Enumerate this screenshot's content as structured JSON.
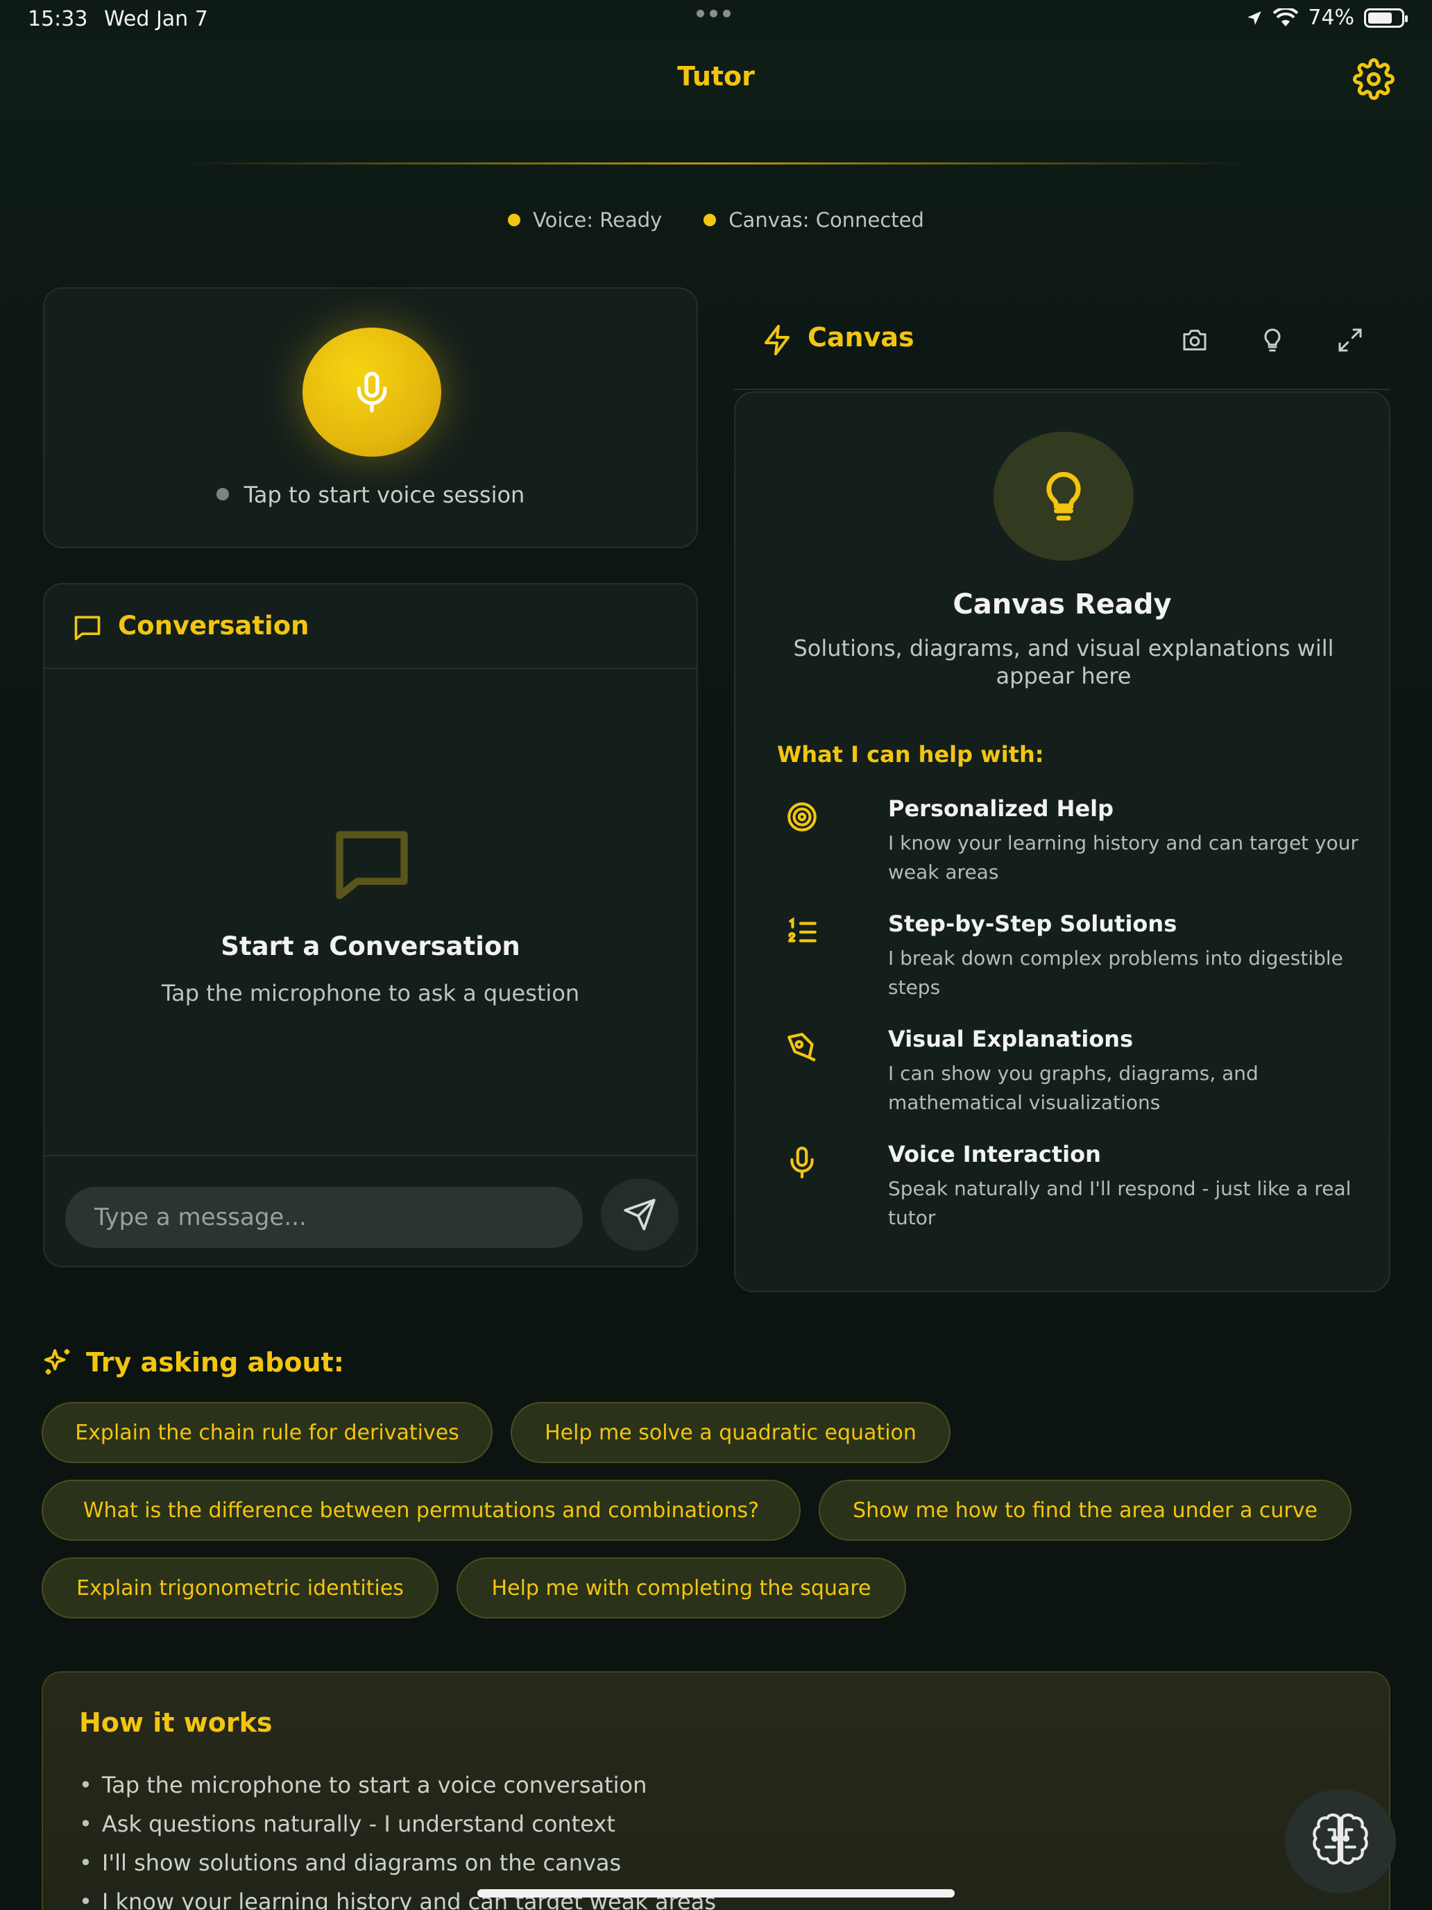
{
  "status_bar": {
    "time": "15:33",
    "date": "Wed Jan 7",
    "battery": "74%",
    "battery_level": 0.74
  },
  "header": {
    "title": "Tutor"
  },
  "connection": {
    "voice": "Voice: Ready",
    "canvas": "Canvas: Connected"
  },
  "voice_panel": {
    "hint": "Tap to start voice session"
  },
  "conversation": {
    "title": "Conversation",
    "empty_title": "Start a Conversation",
    "empty_subtitle": "Tap the microphone to ask a question",
    "input_placeholder": "Type a message..."
  },
  "canvas": {
    "title": "Canvas",
    "ready_title": "Canvas Ready",
    "ready_subtitle": "Solutions, diagrams, and visual explanations will appear here",
    "help_title": "What I can help with:",
    "features": [
      {
        "icon": "target-icon",
        "name": "Personalized Help",
        "desc": "I know your learning history and can target your weak areas"
      },
      {
        "icon": "list-numbered-icon",
        "name": "Step-by-Step Solutions",
        "desc": "I break down complex problems into digestible steps"
      },
      {
        "icon": "pen-tool-icon",
        "name": "Visual Explanations",
        "desc": "I can show you graphs, diagrams, and mathematical visualizations"
      },
      {
        "icon": "microphone-icon",
        "name": "Voice Interaction",
        "desc": "Speak naturally and I'll respond - just like a real tutor"
      }
    ]
  },
  "suggestions": {
    "title": "Try asking about:",
    "items": [
      "Explain the chain rule for derivatives",
      "Help me solve a quadratic equation",
      "What is the difference between permutations and combinations?",
      "Show me how to find the area under a curve",
      "Explain trigonometric identities",
      "Help me with completing the square"
    ]
  },
  "how_it_works": {
    "title": "How it works",
    "items": [
      "Tap the microphone to start a voice conversation",
      "Ask questions naturally - I understand context",
      "I'll show solutions and diagrams on the canvas",
      "I know your learning history and can target weak areas"
    ]
  },
  "colors": {
    "accent": "#f2c511",
    "background": "#0c1612",
    "card": "#141f1b"
  }
}
